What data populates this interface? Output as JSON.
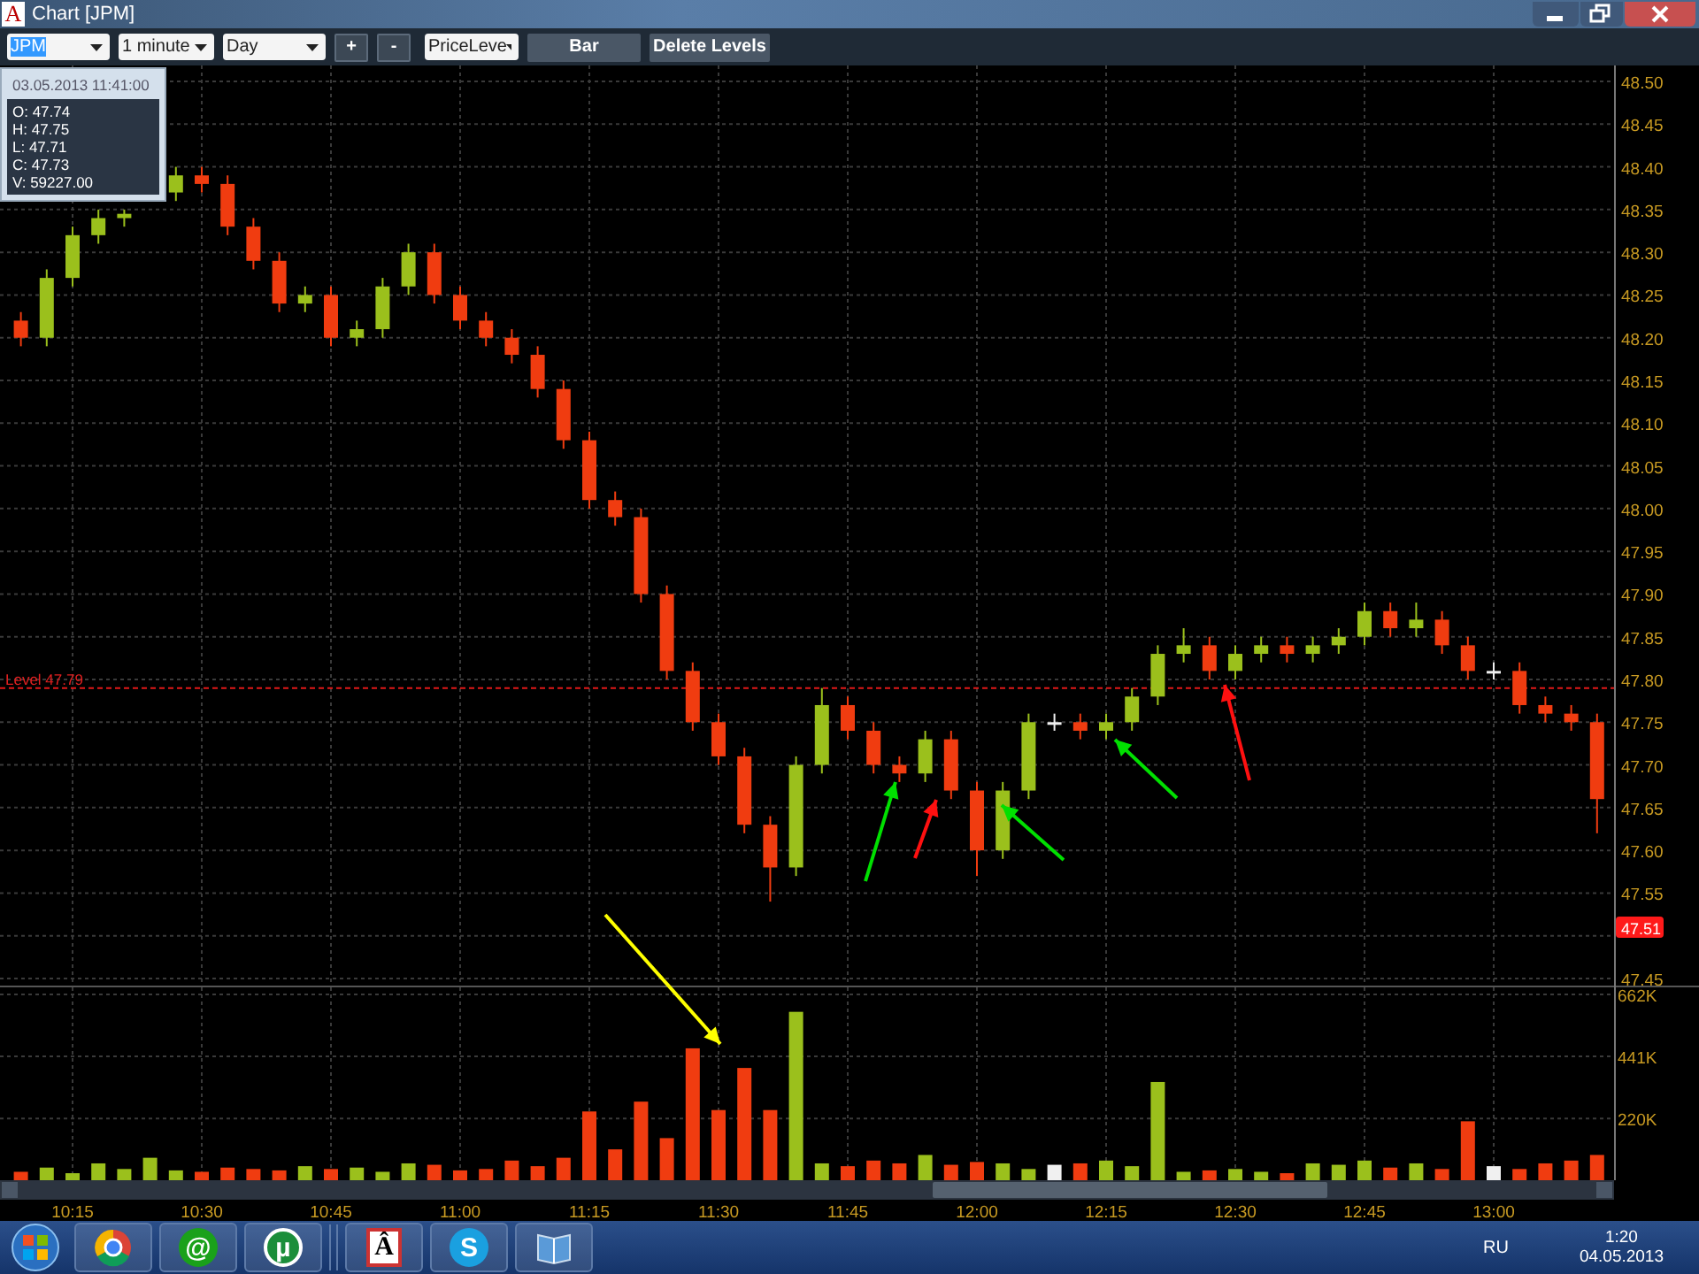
{
  "window": {
    "app_icon": "A",
    "title": "Chart [JPM]"
  },
  "toolbar": {
    "dropdowns": [
      {
        "value": "JPM",
        "text_highlighted": true
      },
      {
        "value": "1 minute",
        "text_highlighted": false
      },
      {
        "value": "Day",
        "text_highlighted": false
      },
      {
        "value": "PriceLeve",
        "text_highlighted": false
      }
    ],
    "buttons": [
      {
        "label": "+",
        "kind": "small"
      },
      {
        "label": "-",
        "kind": "small"
      },
      {
        "label": "Bar",
        "kind": "wide"
      },
      {
        "label": "Delete Levels",
        "kind": "wide"
      }
    ]
  },
  "tooltip": {
    "datetime": "03.05.2013 11:41:00",
    "lines": [
      "O: 47.74",
      "H: 47.75",
      "L: 47.71",
      "C: 47.73",
      "V: 59227.00"
    ]
  },
  "price_chart": {
    "chart_data": {
      "type": "candlestick",
      "grid": true,
      "ylim": [
        47.45,
        48.5
      ],
      "yticks": [
        {
          "value": 48.5,
          "label": "48.50"
        },
        {
          "value": 48.45,
          "label": "48.45"
        },
        {
          "value": 48.4,
          "label": "48.40"
        },
        {
          "value": 48.35,
          "label": "48.35"
        },
        {
          "value": 48.3,
          "label": "48.30"
        },
        {
          "value": 48.25,
          "label": "48.25"
        },
        {
          "value": 48.2,
          "label": "48.20"
        },
        {
          "value": 48.15,
          "label": "48.15"
        },
        {
          "value": 48.1,
          "label": "48.10"
        },
        {
          "value": 48.05,
          "label": "48.05"
        },
        {
          "value": 48.0,
          "label": "48.00"
        },
        {
          "value": 47.95,
          "label": "47.95"
        },
        {
          "value": 47.9,
          "label": "47.90"
        },
        {
          "value": 47.85,
          "label": "47.85"
        },
        {
          "value": 47.8,
          "label": "47.80"
        },
        {
          "value": 47.75,
          "label": "47.75"
        },
        {
          "value": 47.7,
          "label": "47.70"
        },
        {
          "value": 47.65,
          "label": "47.65"
        },
        {
          "value": 47.6,
          "label": "47.60"
        },
        {
          "value": 47.55,
          "label": "47.55"
        },
        {
          "value": 47.45,
          "label": "47.45"
        }
      ],
      "categories": [
        null,
        null,
        null,
        null,
        null,
        null,
        null,
        null,
        null,
        null,
        null,
        null,
        null,
        null,
        null,
        null,
        null,
        null,
        null,
        null,
        null,
        null,
        null,
        null,
        null,
        null,
        null,
        null,
        null,
        null,
        null,
        null,
        null,
        null,
        null,
        null,
        null,
        null,
        null,
        null,
        null,
        null,
        null,
        null,
        null,
        null,
        null,
        null,
        null,
        null,
        null,
        null,
        null,
        null,
        null,
        null,
        null,
        null,
        null,
        null,
        null,
        null
      ],
      "ohlc": [
        [
          48.22,
          48.23,
          48.19,
          48.2
        ],
        [
          48.2,
          48.28,
          48.19,
          48.27
        ],
        [
          48.27,
          48.33,
          48.26,
          48.32
        ],
        [
          48.32,
          48.35,
          48.31,
          48.34
        ],
        [
          48.34,
          48.35,
          48.33,
          48.345
        ],
        null,
        [
          48.37,
          48.4,
          48.36,
          48.39
        ],
        [
          48.39,
          48.4,
          48.37,
          48.38
        ],
        [
          48.38,
          48.39,
          48.32,
          48.33
        ],
        [
          48.33,
          48.34,
          48.28,
          48.29
        ],
        [
          48.29,
          48.3,
          48.23,
          48.24
        ],
        [
          48.24,
          48.26,
          48.23,
          48.25
        ],
        [
          48.25,
          48.26,
          48.19,
          48.2
        ],
        [
          48.2,
          48.22,
          48.19,
          48.21
        ],
        [
          48.21,
          48.27,
          48.2,
          48.26
        ],
        [
          48.26,
          48.31,
          48.25,
          48.3
        ],
        [
          48.3,
          48.31,
          48.24,
          48.25
        ],
        [
          48.25,
          48.26,
          48.21,
          48.22
        ],
        [
          48.22,
          48.23,
          48.19,
          48.2
        ],
        [
          48.2,
          48.21,
          48.17,
          48.18
        ],
        [
          48.18,
          48.19,
          48.13,
          48.14
        ],
        [
          48.14,
          48.15,
          48.07,
          48.08
        ],
        [
          48.08,
          48.09,
          48.0,
          48.01
        ],
        [
          48.01,
          48.02,
          47.98,
          47.99
        ],
        [
          47.99,
          48.0,
          47.89,
          47.9
        ],
        [
          47.9,
          47.91,
          47.8,
          47.81
        ],
        [
          47.81,
          47.82,
          47.74,
          47.75
        ],
        [
          47.75,
          47.76,
          47.7,
          47.71
        ],
        [
          47.71,
          47.72,
          47.62,
          47.63
        ],
        [
          47.63,
          47.64,
          47.54,
          47.58
        ],
        [
          47.58,
          47.71,
          47.57,
          47.7
        ],
        [
          47.7,
          47.79,
          47.69,
          47.77
        ],
        [
          47.77,
          47.78,
          47.73,
          47.74
        ],
        [
          47.74,
          47.75,
          47.69,
          47.7
        ],
        [
          47.7,
          47.71,
          47.68,
          47.69
        ],
        [
          47.69,
          47.74,
          47.68,
          47.73
        ],
        [
          47.73,
          47.74,
          47.66,
          47.67
        ],
        [
          47.67,
          47.68,
          47.57,
          47.6
        ],
        [
          47.6,
          47.68,
          47.59,
          47.67
        ],
        [
          47.67,
          47.76,
          47.66,
          47.75
        ],
        [
          47.75,
          47.76,
          47.74,
          47.75
        ],
        [
          47.75,
          47.76,
          47.73,
          47.74
        ],
        [
          47.74,
          47.76,
          47.73,
          47.75
        ],
        [
          47.75,
          47.79,
          47.74,
          47.78
        ],
        [
          47.78,
          47.84,
          47.77,
          47.83
        ],
        [
          47.83,
          47.86,
          47.82,
          47.84
        ],
        [
          47.84,
          47.85,
          47.8,
          47.81
        ],
        [
          47.81,
          47.84,
          47.8,
          47.83
        ],
        [
          47.83,
          47.85,
          47.82,
          47.84
        ],
        [
          47.84,
          47.85,
          47.82,
          47.83
        ],
        [
          47.83,
          47.85,
          47.82,
          47.84
        ],
        [
          47.84,
          47.86,
          47.83,
          47.85
        ],
        [
          47.85,
          47.89,
          47.84,
          47.88
        ],
        [
          47.88,
          47.89,
          47.85,
          47.86
        ],
        [
          47.86,
          47.89,
          47.85,
          47.87
        ],
        [
          47.87,
          47.88,
          47.83,
          47.84
        ],
        [
          47.84,
          47.85,
          47.8,
          47.81
        ],
        [
          47.81,
          47.82,
          47.8,
          47.81
        ],
        [
          47.81,
          47.82,
          47.76,
          47.77
        ],
        [
          47.77,
          47.78,
          47.75,
          47.76
        ],
        [
          47.76,
          47.77,
          47.74,
          47.75
        ],
        [
          47.75,
          47.76,
          47.62,
          47.66
        ]
      ],
      "ref_lines": [
        {
          "axis": "y",
          "value": 47.79,
          "label": "Level 47.79"
        }
      ],
      "annotations": [
        {
          "text": "47.51"
        }
      ]
    }
  },
  "volume_chart": {
    "chart_data": {
      "type": "bar",
      "grid": true,
      "ylim": [
        0,
        662
      ],
      "yticks": [
        {
          "value": 662,
          "label": "662K"
        },
        {
          "value": 441,
          "label": "441K"
        },
        {
          "value": 220,
          "label": "220K"
        }
      ],
      "categories": [
        null,
        null,
        "10:15",
        null,
        null,
        null,
        null,
        "10:30",
        null,
        null,
        null,
        null,
        "10:45",
        null,
        null,
        null,
        null,
        "11:00",
        null,
        null,
        null,
        null,
        "11:15",
        null,
        null,
        null,
        null,
        "11:30",
        null,
        null,
        null,
        null,
        "11:45",
        null,
        null,
        null,
        null,
        "12:00",
        null,
        null,
        null,
        null,
        "12:15",
        null,
        null,
        null,
        null,
        "12:30",
        null,
        null,
        null,
        null,
        "12:45",
        null,
        null,
        null,
        null,
        "13:00",
        null,
        null,
        null,
        null
      ],
      "values": [
        30,
        45,
        25,
        60,
        40,
        80,
        35,
        30,
        45,
        40,
        35,
        50,
        40,
        45,
        30,
        60,
        55,
        35,
        40,
        70,
        50,
        80,
        245,
        110,
        280,
        150,
        470,
        250,
        400,
        250,
        600,
        60,
        50,
        70,
        60,
        90,
        55,
        65,
        60,
        40,
        55,
        60,
        70,
        50,
        350,
        30,
        35,
        40,
        30,
        25,
        60,
        55,
        70,
        45,
        60,
        40,
        210,
        50,
        40,
        60,
        70,
        90
      ]
    }
  },
  "arrows": [
    {
      "color": "#ffff00"
    },
    {
      "color": "#00e000"
    },
    {
      "color": "#ff1010"
    },
    {
      "color": "#00e000"
    },
    {
      "color": "#00e000"
    },
    {
      "color": "#ff1010"
    }
  ],
  "taskbar": {
    "apps": [
      {
        "kind": "browser"
      },
      {
        "kind": "mail",
        "glyph": "@"
      },
      {
        "kind": "torrent",
        "glyph": "µ"
      },
      {
        "kind": "dictionary",
        "glyph": "Â"
      },
      {
        "kind": "chat",
        "glyph": "S"
      },
      {
        "kind": "book"
      }
    ],
    "language": "RU",
    "time": "1:20",
    "date": "04.05.2013"
  }
}
